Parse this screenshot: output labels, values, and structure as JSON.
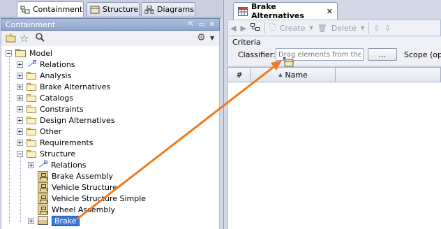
{
  "left_tabs": [
    {
      "label": "Containment",
      "icon": "containment-icon"
    },
    {
      "label": "Structure",
      "icon": "structure-icon"
    },
    {
      "label": "Diagrams",
      "icon": "diagrams-icon"
    }
  ],
  "panel": {
    "title": "Containment"
  },
  "tree": {
    "root": "Model",
    "items": [
      {
        "label": "Relations",
        "icon": "relations-icon"
      },
      {
        "label": "Analysis",
        "icon": "folder-icon"
      },
      {
        "label": "Brake Alternatives",
        "icon": "folder-icon"
      },
      {
        "label": "Catalogs",
        "icon": "folder-icon"
      },
      {
        "label": "Constraints",
        "icon": "folder-icon"
      },
      {
        "label": "Design Alternatives",
        "icon": "folder-icon"
      },
      {
        "label": "Other",
        "icon": "folder-icon"
      },
      {
        "label": "Requirements",
        "icon": "folder-icon"
      },
      {
        "label": "Structure",
        "icon": "folder-icon"
      }
    ],
    "structure_children": [
      {
        "label": "Relations",
        "icon": "relations-icon"
      },
      {
        "label": "Brake Assembly",
        "icon": "diagram-icon"
      },
      {
        "label": "Vehicle Structure",
        "icon": "diagram-icon"
      },
      {
        "label": "Vehicle Structure Simple",
        "icon": "diagram-icon"
      },
      {
        "label": "Wheel Assembly",
        "icon": "diagram-icon"
      },
      {
        "label": "Brake",
        "icon": "block-icon"
      }
    ]
  },
  "right_tab": {
    "label": "Brake Alternatives",
    "close": "✕"
  },
  "toolbar": {
    "create": "Create",
    "delete": "Delete"
  },
  "criteria": {
    "legend": "Criteria",
    "classifier_label": "Classifier:",
    "classifier_placeholder": "Drag elements from the M",
    "browse_button": "...",
    "scope_label": "Scope (op"
  },
  "table": {
    "columns": [
      "#",
      "Name"
    ]
  },
  "colors": {
    "accent_arrow": "#f07a1e",
    "selection": "#3c79d8"
  }
}
